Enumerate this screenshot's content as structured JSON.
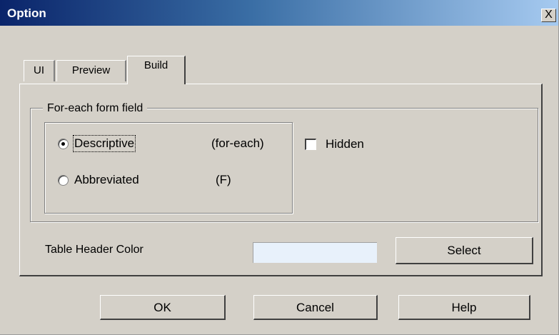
{
  "window": {
    "title": "Option",
    "close_label": "X"
  },
  "tabs": [
    {
      "label": "UI",
      "active": false
    },
    {
      "label": "Preview",
      "active": false
    },
    {
      "label": "Build",
      "active": true
    }
  ],
  "build": {
    "group_title": "For-each form field",
    "options": [
      {
        "label": "Descriptive",
        "value": "(for-each)",
        "selected": true
      },
      {
        "label": "Abbreviated",
        "value": "(F)",
        "selected": false
      }
    ],
    "hidden": {
      "label": "Hidden",
      "checked": false
    },
    "table_header_color": {
      "label": "Table Header Color",
      "color": "#e8f1fb",
      "button": "Select"
    }
  },
  "buttons": {
    "ok": "OK",
    "cancel": "Cancel",
    "help": "Help"
  }
}
